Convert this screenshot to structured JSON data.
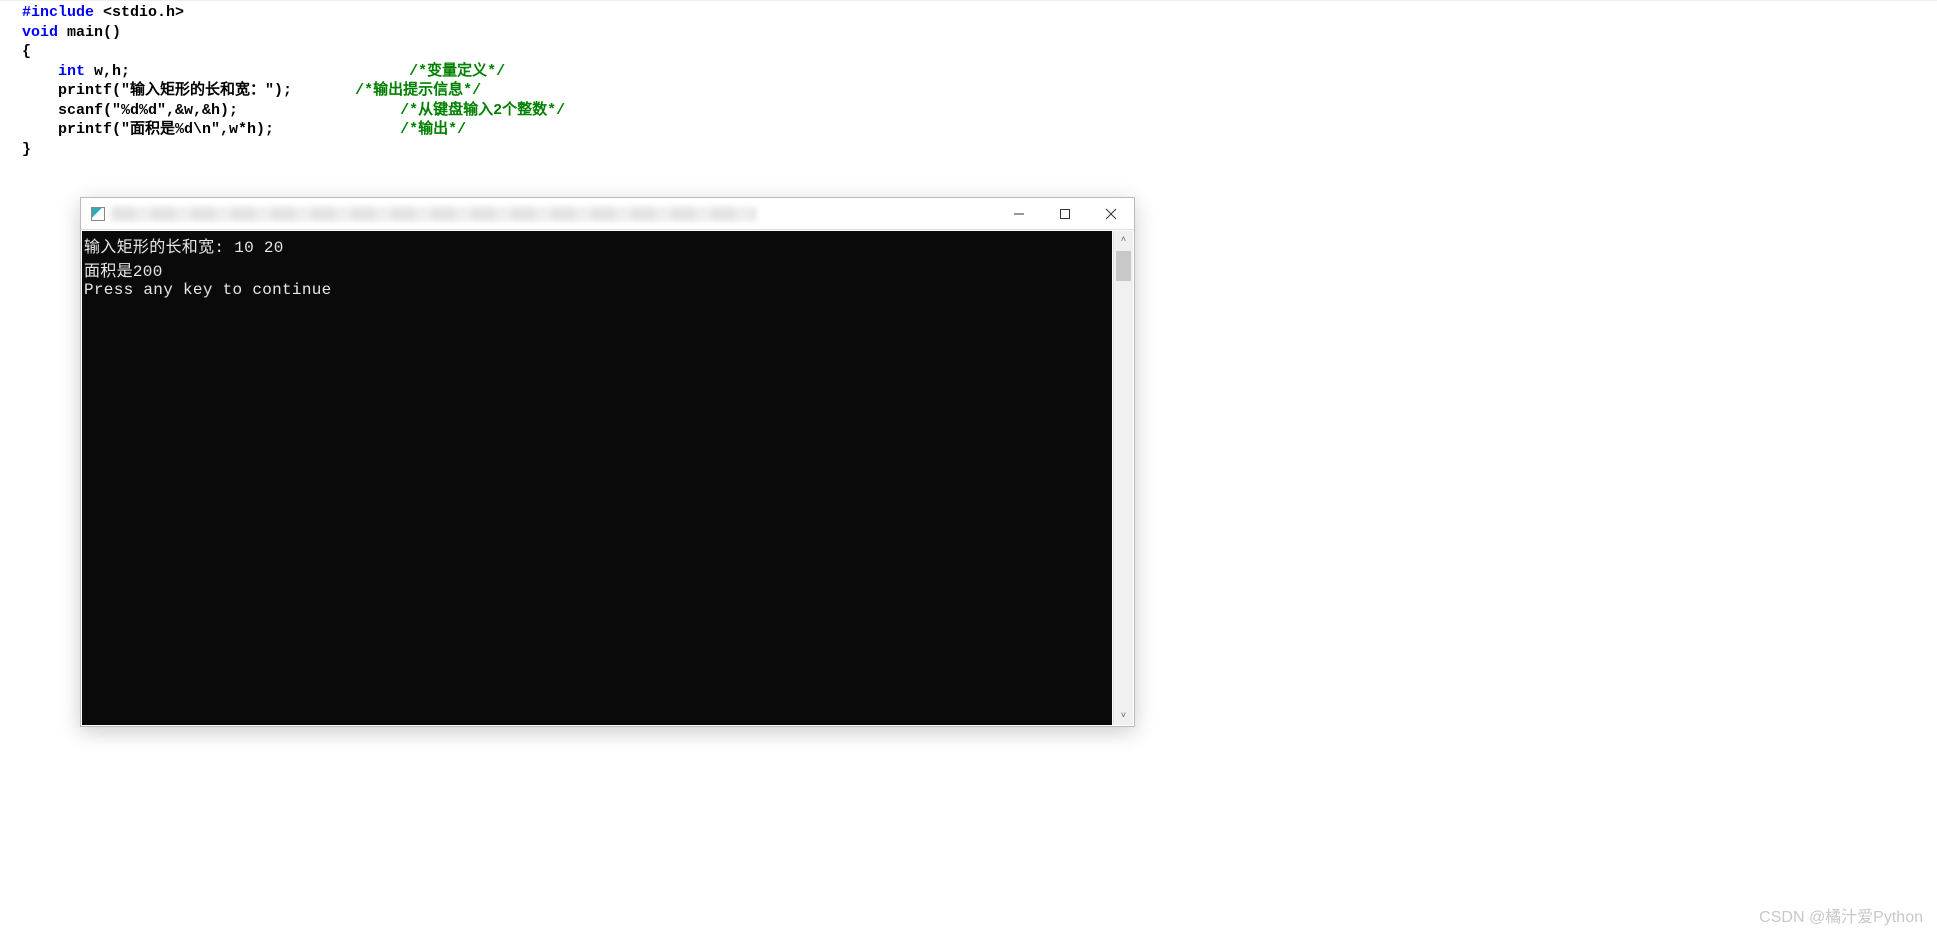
{
  "code": {
    "l1": {
      "kw": "#include",
      "rest": " <stdio.h>"
    },
    "l2": {
      "kw": "void",
      "rest": " main()"
    },
    "l3": {
      "plain": "{"
    },
    "l4": {
      "indent": "    ",
      "kw": "int",
      "rest": " w,h;",
      "pad": "                               ",
      "cm": "/*变量定义*/"
    },
    "l5": {
      "indent": "    ",
      "plain": "printf(\"输入矩形的长和宽：\");",
      "pad": "       ",
      "cm": "/*输出提示信息*/"
    },
    "l6": {
      "indent": "    ",
      "plain": "scanf(\"%d%d\",&w,&h);",
      "pad": "                  ",
      "cm": "/*从键盘输入2个整数*/"
    },
    "l7": {
      "indent": "    ",
      "plain": "printf(\"面积是%d\\n\",w*h);",
      "pad": "              ",
      "cm": "/*输出*/"
    },
    "l8": {
      "plain": "}"
    }
  },
  "console": {
    "line1": "输入矩形的长和宽: 10 20",
    "line2": "面积是200",
    "line3": "Press any key to continue"
  },
  "titlebar": {
    "minimize": "—",
    "maximize": "☐",
    "close": "✕"
  },
  "scroll": {
    "up": "˄",
    "down": "˅"
  },
  "watermark": "CSDN @橘汁爱Python"
}
